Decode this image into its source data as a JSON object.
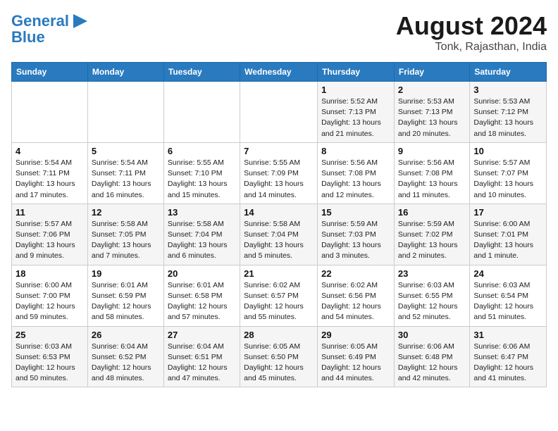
{
  "header": {
    "logo_line1": "General",
    "logo_line2": "Blue",
    "month_title": "August 2024",
    "location": "Tonk, Rajasthan, India"
  },
  "days_of_week": [
    "Sunday",
    "Monday",
    "Tuesday",
    "Wednesday",
    "Thursday",
    "Friday",
    "Saturday"
  ],
  "weeks": [
    [
      {
        "day": "",
        "info": ""
      },
      {
        "day": "",
        "info": ""
      },
      {
        "day": "",
        "info": ""
      },
      {
        "day": "",
        "info": ""
      },
      {
        "day": "1",
        "info": "Sunrise: 5:52 AM\nSunset: 7:13 PM\nDaylight: 13 hours\nand 21 minutes."
      },
      {
        "day": "2",
        "info": "Sunrise: 5:53 AM\nSunset: 7:13 PM\nDaylight: 13 hours\nand 20 minutes."
      },
      {
        "day": "3",
        "info": "Sunrise: 5:53 AM\nSunset: 7:12 PM\nDaylight: 13 hours\nand 18 minutes."
      }
    ],
    [
      {
        "day": "4",
        "info": "Sunrise: 5:54 AM\nSunset: 7:11 PM\nDaylight: 13 hours\nand 17 minutes."
      },
      {
        "day": "5",
        "info": "Sunrise: 5:54 AM\nSunset: 7:11 PM\nDaylight: 13 hours\nand 16 minutes."
      },
      {
        "day": "6",
        "info": "Sunrise: 5:55 AM\nSunset: 7:10 PM\nDaylight: 13 hours\nand 15 minutes."
      },
      {
        "day": "7",
        "info": "Sunrise: 5:55 AM\nSunset: 7:09 PM\nDaylight: 13 hours\nand 14 minutes."
      },
      {
        "day": "8",
        "info": "Sunrise: 5:56 AM\nSunset: 7:08 PM\nDaylight: 13 hours\nand 12 minutes."
      },
      {
        "day": "9",
        "info": "Sunrise: 5:56 AM\nSunset: 7:08 PM\nDaylight: 13 hours\nand 11 minutes."
      },
      {
        "day": "10",
        "info": "Sunrise: 5:57 AM\nSunset: 7:07 PM\nDaylight: 13 hours\nand 10 minutes."
      }
    ],
    [
      {
        "day": "11",
        "info": "Sunrise: 5:57 AM\nSunset: 7:06 PM\nDaylight: 13 hours\nand 9 minutes."
      },
      {
        "day": "12",
        "info": "Sunrise: 5:58 AM\nSunset: 7:05 PM\nDaylight: 13 hours\nand 7 minutes."
      },
      {
        "day": "13",
        "info": "Sunrise: 5:58 AM\nSunset: 7:04 PM\nDaylight: 13 hours\nand 6 minutes."
      },
      {
        "day": "14",
        "info": "Sunrise: 5:58 AM\nSunset: 7:04 PM\nDaylight: 13 hours\nand 5 minutes."
      },
      {
        "day": "15",
        "info": "Sunrise: 5:59 AM\nSunset: 7:03 PM\nDaylight: 13 hours\nand 3 minutes."
      },
      {
        "day": "16",
        "info": "Sunrise: 5:59 AM\nSunset: 7:02 PM\nDaylight: 13 hours\nand 2 minutes."
      },
      {
        "day": "17",
        "info": "Sunrise: 6:00 AM\nSunset: 7:01 PM\nDaylight: 13 hours\nand 1 minute."
      }
    ],
    [
      {
        "day": "18",
        "info": "Sunrise: 6:00 AM\nSunset: 7:00 PM\nDaylight: 12 hours\nand 59 minutes."
      },
      {
        "day": "19",
        "info": "Sunrise: 6:01 AM\nSunset: 6:59 PM\nDaylight: 12 hours\nand 58 minutes."
      },
      {
        "day": "20",
        "info": "Sunrise: 6:01 AM\nSunset: 6:58 PM\nDaylight: 12 hours\nand 57 minutes."
      },
      {
        "day": "21",
        "info": "Sunrise: 6:02 AM\nSunset: 6:57 PM\nDaylight: 12 hours\nand 55 minutes."
      },
      {
        "day": "22",
        "info": "Sunrise: 6:02 AM\nSunset: 6:56 PM\nDaylight: 12 hours\nand 54 minutes."
      },
      {
        "day": "23",
        "info": "Sunrise: 6:03 AM\nSunset: 6:55 PM\nDaylight: 12 hours\nand 52 minutes."
      },
      {
        "day": "24",
        "info": "Sunrise: 6:03 AM\nSunset: 6:54 PM\nDaylight: 12 hours\nand 51 minutes."
      }
    ],
    [
      {
        "day": "25",
        "info": "Sunrise: 6:03 AM\nSunset: 6:53 PM\nDaylight: 12 hours\nand 50 minutes."
      },
      {
        "day": "26",
        "info": "Sunrise: 6:04 AM\nSunset: 6:52 PM\nDaylight: 12 hours\nand 48 minutes."
      },
      {
        "day": "27",
        "info": "Sunrise: 6:04 AM\nSunset: 6:51 PM\nDaylight: 12 hours\nand 47 minutes."
      },
      {
        "day": "28",
        "info": "Sunrise: 6:05 AM\nSunset: 6:50 PM\nDaylight: 12 hours\nand 45 minutes."
      },
      {
        "day": "29",
        "info": "Sunrise: 6:05 AM\nSunset: 6:49 PM\nDaylight: 12 hours\nand 44 minutes."
      },
      {
        "day": "30",
        "info": "Sunrise: 6:06 AM\nSunset: 6:48 PM\nDaylight: 12 hours\nand 42 minutes."
      },
      {
        "day": "31",
        "info": "Sunrise: 6:06 AM\nSunset: 6:47 PM\nDaylight: 12 hours\nand 41 minutes."
      }
    ]
  ]
}
